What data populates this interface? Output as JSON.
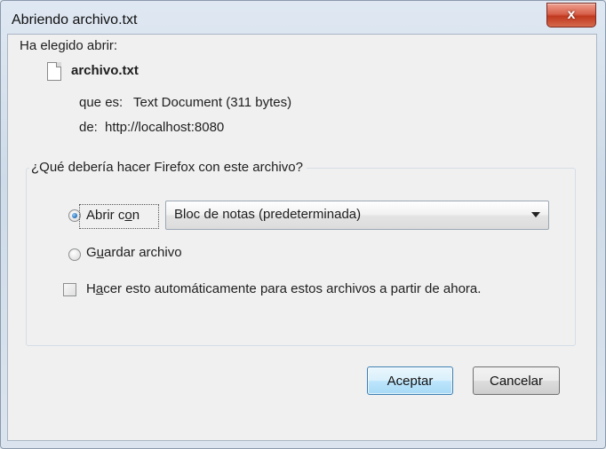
{
  "window": {
    "title": "Abriendo archivo.txt",
    "close_symbol": "x"
  },
  "intro": "Ha elegido abrir:",
  "file": {
    "name": "archivo.txt",
    "type_label": "que es:",
    "type_value": "Text Document (311 bytes)",
    "from_label": "de:",
    "from_value": "http://localhost:8080"
  },
  "question": "¿Qué debería hacer Firefox con este archivo?",
  "options": {
    "open_with": {
      "label_a": "Abrir c",
      "label_key": "o",
      "label_b": "n",
      "selected": true
    },
    "app_select": {
      "value": "Bloc de notas (predeterminada)"
    },
    "save_file": {
      "label_a": "G",
      "label_key": "u",
      "label_b": "ardar archivo",
      "selected": false
    },
    "auto": {
      "label_a": "H",
      "label_key": "a",
      "label_b": "cer esto automáticamente para estos archivos a partir de ahora.",
      "checked": false
    }
  },
  "buttons": {
    "ok": "Aceptar",
    "cancel": "Cancelar"
  },
  "icons": {
    "file": "text-file-icon",
    "close": "close-icon",
    "dropdown": "chevron-down-icon"
  }
}
